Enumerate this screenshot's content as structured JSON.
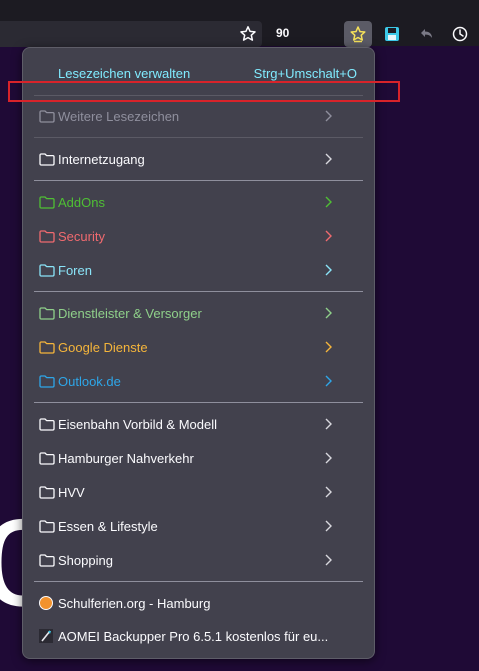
{
  "toolbar": {
    "tracking_count": "90"
  },
  "bookmarks_menu": {
    "manage_label": "Lesezeichen verwalten",
    "manage_shortcut": "Strg+Umschalt+O",
    "items": [
      {
        "label": "Weitere Lesezeichen",
        "color": "#8f8f9d",
        "type": "folder"
      },
      {
        "label": "Internetzugang",
        "color": "#fbfbfe",
        "type": "folder"
      },
      {
        "label": "AddOns",
        "color": "#4fbf34",
        "type": "folder"
      },
      {
        "label": "Security",
        "color": "#f06a6f",
        "type": "folder"
      },
      {
        "label": "Foren",
        "color": "#8ae4f8",
        "type": "folder"
      },
      {
        "label": "Dienstleister & Versorger",
        "color": "#8fd08a",
        "type": "folder"
      },
      {
        "label": "Google Dienste",
        "color": "#f5b53b",
        "type": "folder"
      },
      {
        "label": "Outlook.de",
        "color": "#2ea6e8",
        "type": "folder"
      },
      {
        "label": "Eisenbahn Vorbild & Modell",
        "color": "#fbfbfe",
        "type": "folder"
      },
      {
        "label": "Hamburger Nahverkehr",
        "color": "#fbfbfe",
        "type": "folder"
      },
      {
        "label": "HVV",
        "color": "#fbfbfe",
        "type": "folder"
      },
      {
        "label": "Essen & Lifestyle",
        "color": "#fbfbfe",
        "type": "folder"
      },
      {
        "label": "Shopping",
        "color": "#fbfbfe",
        "type": "folder"
      },
      {
        "label": "Schulferien.org - Hamburg",
        "color": "#fbfbfe",
        "type": "bookmark",
        "icon": "schulferien-favicon"
      },
      {
        "label": "AOMEI Backupper Pro 6.5.1 kostenlos für eu...",
        "color": "#fbfbfe",
        "type": "bookmark",
        "icon": "aomei-favicon"
      }
    ]
  }
}
